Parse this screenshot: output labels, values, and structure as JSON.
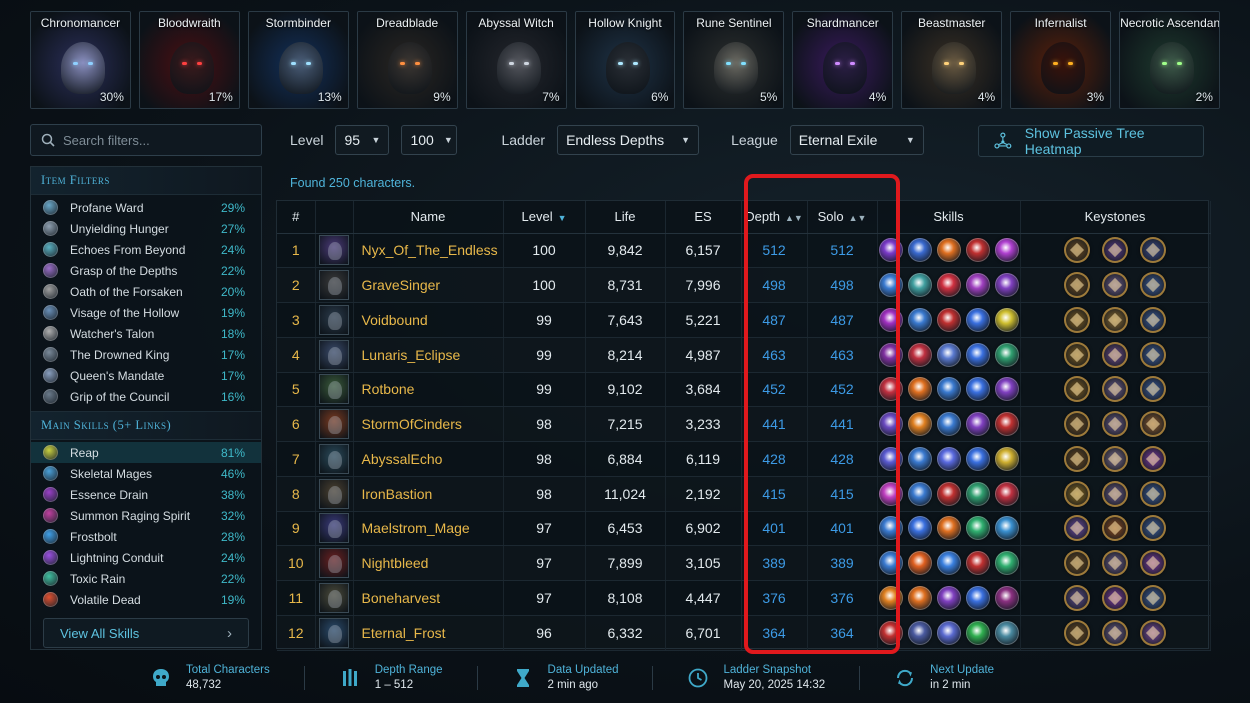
{
  "classes": [
    {
      "name": "Chronomancer",
      "pct": "30%",
      "bg": "#2b2f5a",
      "eye": "#8fd0ff",
      "face": "#8a8fc0"
    },
    {
      "name": "Bloodwraith",
      "pct": "17%",
      "bg": "#4a0f12",
      "eye": "#ff4040",
      "face": "#3a1a1c"
    },
    {
      "name": "Stormbinder",
      "pct": "13%",
      "bg": "#13305a",
      "eye": "#9fe0ff",
      "face": "#4a5d78"
    },
    {
      "name": "Dreadblade",
      "pct": "9%",
      "bg": "#2a2622",
      "eye": "#ff9040",
      "face": "#3b3632"
    },
    {
      "name": "Abyssal Witch",
      "pct": "7%",
      "bg": "#24262c",
      "eye": "#cfd6e0",
      "face": "#55575e"
    },
    {
      "name": "Hollow Knight",
      "pct": "6%",
      "bg": "#1f3347",
      "eye": "#aee8ff",
      "face": "#2a2f36"
    },
    {
      "name": "Rune Sentinel",
      "pct": "5%",
      "bg": "#2c2f2e",
      "eye": "#80e0ff",
      "face": "#6b6a62"
    },
    {
      "name": "Shardmancer",
      "pct": "4%",
      "bg": "#3a1a5e",
      "eye": "#d08bff",
      "face": "#2b1e45"
    },
    {
      "name": "Beastmaster",
      "pct": "4%",
      "bg": "#3a3024",
      "eye": "#ffd27a",
      "face": "#6a5a42"
    },
    {
      "name": "Infernalist",
      "pct": "3%",
      "bg": "#5a200a",
      "eye": "#ffb020",
      "face": "#3a120a"
    },
    {
      "name": "Necrotic Ascendant",
      "pct": "2%",
      "bg": "#1e3a2e",
      "eye": "#a0ff8a",
      "face": "#3e5a4a"
    }
  ],
  "search": {
    "placeholder": "Search filters..."
  },
  "item_filters": {
    "title": "Item Filters",
    "items": [
      {
        "label": "Profane Ward",
        "value": "29%",
        "color": "#6aa7c8"
      },
      {
        "label": "Unyielding Hunger",
        "value": "27%",
        "color": "#8fa0b0"
      },
      {
        "label": "Echoes From Beyond",
        "value": "24%",
        "color": "#5ab0c0"
      },
      {
        "label": "Grasp of the Depths",
        "value": "22%",
        "color": "#9a6ec8"
      },
      {
        "label": "Oath of the Forsaken",
        "value": "20%",
        "color": "#a0a0a0"
      },
      {
        "label": "Visage of the Hollow",
        "value": "19%",
        "color": "#6a90b8"
      },
      {
        "label": "Watcher's Talon",
        "value": "18%",
        "color": "#b0b0b0"
      },
      {
        "label": "The Drowned King",
        "value": "17%",
        "color": "#7a8a9a"
      },
      {
        "label": "Queen's Mandate",
        "value": "17%",
        "color": "#8aa0c0"
      },
      {
        "label": "Grip of the Council",
        "value": "16%",
        "color": "#6a7a8a"
      }
    ]
  },
  "main_skills": {
    "title": "Main Skills (5+ Links)",
    "items": [
      {
        "label": "Reap",
        "value": "81%",
        "color": "#c8d040"
      },
      {
        "label": "Skeletal Mages",
        "value": "46%",
        "color": "#4aa0d8"
      },
      {
        "label": "Essence Drain",
        "value": "38%",
        "color": "#9a40c8"
      },
      {
        "label": "Summon Raging Spirit",
        "value": "32%",
        "color": "#c040a0"
      },
      {
        "label": "Frostbolt",
        "value": "28%",
        "color": "#40a0e8"
      },
      {
        "label": "Lightning Conduit",
        "value": "24%",
        "color": "#9a50e0"
      },
      {
        "label": "Toxic Rain",
        "value": "22%",
        "color": "#40c0a0"
      },
      {
        "label": "Volatile Dead",
        "value": "19%",
        "color": "#e05030"
      }
    ],
    "view_all_label": "View All Skills"
  },
  "controls": {
    "level_label": "Level",
    "level_min": "95",
    "level_max": "100",
    "ladder_label": "Ladder",
    "ladder_value": "Endless Depths",
    "league_label": "League",
    "league_value": "Eternal Exile",
    "heatmap_label": "Show Passive Tree Heatmap"
  },
  "found_text": "Found 250 characters.",
  "table": {
    "headers": {
      "rank": "#",
      "name": "Name",
      "level": "Level",
      "life": "Life",
      "es": "ES",
      "depth": "Depth",
      "solo": "Solo",
      "skills": "Skills",
      "keystones": "Keystones"
    },
    "rows": [
      {
        "rank": "1",
        "name": "Nyx_Of_The_Endless",
        "level": "100",
        "life": "9,842",
        "es": "6,157",
        "depth": "512",
        "solo": "512",
        "avatar": "#4a3a78",
        "skills": [
          "#7a3ac8",
          "#3a6ad0",
          "#e07020",
          "#c03030",
          "#b040d0"
        ],
        "keystones": [
          "#6a4a20",
          "#5a3a8a",
          "#3a4a8a"
        ]
      },
      {
        "rank": "2",
        "name": "GraveSinger",
        "level": "100",
        "life": "8,731",
        "es": "7,996",
        "depth": "498",
        "solo": "498",
        "avatar": "#3a3a3a",
        "skills": [
          "#3a7ad0",
          "#40a0a0",
          "#d03040",
          "#a040c0",
          "#8040c0"
        ],
        "keystones": [
          "#6a4a20",
          "#6a5a8a",
          "#3a5a9a"
        ]
      },
      {
        "rank": "3",
        "name": "Voidbound",
        "level": "99",
        "life": "7,643",
        "es": "5,221",
        "depth": "487",
        "solo": "487",
        "avatar": "#2a3a4a",
        "skills": [
          "#a030c0",
          "#3a7ad0",
          "#c03030",
          "#3a70e0",
          "#d0c030"
        ],
        "keystones": [
          "#7a5a20",
          "#8a6a30",
          "#3a5a9a"
        ]
      },
      {
        "rank": "4",
        "name": "Lunaris_Eclipse",
        "level": "99",
        "life": "8,214",
        "es": "4,987",
        "depth": "463",
        "solo": "463",
        "avatar": "#3a4a6a",
        "skills": [
          "#8030a0",
          "#c03040",
          "#5a7ad0",
          "#3a70e0",
          "#30a070"
        ],
        "keystones": [
          "#7a5a20",
          "#6a4a8a",
          "#3a5a9a"
        ]
      },
      {
        "rank": "5",
        "name": "Rotbone",
        "level": "99",
        "life": "9,102",
        "es": "3,684",
        "depth": "452",
        "solo": "452",
        "avatar": "#3a5a3a",
        "skills": [
          "#c03040",
          "#e07020",
          "#3a7ad0",
          "#3a70e0",
          "#8040c0"
        ],
        "keystones": [
          "#7a5a20",
          "#6a5a8a",
          "#3a5a9a"
        ]
      },
      {
        "rank": "6",
        "name": "StormOfCinders",
        "level": "98",
        "life": "7,215",
        "es": "3,233",
        "depth": "441",
        "solo": "441",
        "avatar": "#7a3a20",
        "skills": [
          "#6a4ac0",
          "#e08020",
          "#3a7ad0",
          "#8040c0",
          "#c03030"
        ],
        "keystones": [
          "#6a4a20",
          "#6a5a8a",
          "#8a5a30"
        ]
      },
      {
        "rank": "7",
        "name": "AbyssalEcho",
        "level": "98",
        "life": "6,884",
        "es": "6,119",
        "depth": "428",
        "solo": "428",
        "avatar": "#2a4a5a",
        "skills": [
          "#5a5ad0",
          "#3a7ad0",
          "#5a6ae0",
          "#3a70e0",
          "#d0b030"
        ],
        "keystones": [
          "#6a4a20",
          "#7a6a8a",
          "#7a3aa0"
        ]
      },
      {
        "rank": "8",
        "name": "IronBastion",
        "level": "98",
        "life": "11,024",
        "es": "2,192",
        "depth": "415",
        "solo": "415",
        "avatar": "#4a4030",
        "skills": [
          "#c040c0",
          "#3a7ad0",
          "#c03030",
          "#30a070",
          "#c03040"
        ],
        "keystones": [
          "#8a6a20",
          "#6a5a8a",
          "#3a5a9a"
        ]
      },
      {
        "rank": "9",
        "name": "Maelstrom_Mage",
        "level": "97",
        "life": "6,453",
        "es": "6,902",
        "depth": "401",
        "solo": "401",
        "avatar": "#3a3a7a",
        "skills": [
          "#3a7ad0",
          "#3a70e0",
          "#e07020",
          "#30b070",
          "#3a90d0"
        ],
        "keystones": [
          "#6a4aa0",
          "#8a4a20",
          "#3a5a9a"
        ]
      },
      {
        "rank": "10",
        "name": "Nightbleed",
        "level": "97",
        "life": "7,899",
        "es": "3,105",
        "depth": "389",
        "solo": "389",
        "avatar": "#6a2020",
        "skills": [
          "#3a7ad0",
          "#e06020",
          "#3a80e0",
          "#c03030",
          "#30b070"
        ],
        "keystones": [
          "#6a4a20",
          "#6a5a8a",
          "#7a3aa0"
        ]
      },
      {
        "rank": "11",
        "name": "Boneharvest",
        "level": "97",
        "life": "8,108",
        "es": "4,447",
        "depth": "376",
        "solo": "376",
        "avatar": "#4a4a3a",
        "skills": [
          "#e08020",
          "#e07020",
          "#8040c0",
          "#3a70e0",
          "#8a3080"
        ],
        "keystones": [
          "#5a4a8a",
          "#7a3aa0",
          "#3a5a9a"
        ]
      },
      {
        "rank": "12",
        "name": "Eternal_Frost",
        "level": "96",
        "life": "6,332",
        "es": "6,701",
        "depth": "364",
        "solo": "364",
        "avatar": "#2a4a6a",
        "skills": [
          "#c03030",
          "#4a5aa0",
          "#5a6ad0",
          "#30b050",
          "#4a8aa0"
        ],
        "keystones": [
          "#6a4a20",
          "#6a5a8a",
          "#7a4aa0"
        ]
      }
    ]
  },
  "footer": {
    "total_label": "Total Characters",
    "total_value": "48,732",
    "depth_label": "Depth Range",
    "depth_value": "1 – 512",
    "updated_label": "Data Updated",
    "updated_value": "2 min ago",
    "snapshot_label": "Ladder Snapshot",
    "snapshot_value": "May 20, 2025 14:32",
    "next_label": "Next Update",
    "next_value": "in 2 min"
  },
  "colors": {
    "accent": "#4fb3d9",
    "name_gold": "#e8b84a",
    "depth_blue": "#3d9be6",
    "highlight_red": "#e0191d"
  }
}
